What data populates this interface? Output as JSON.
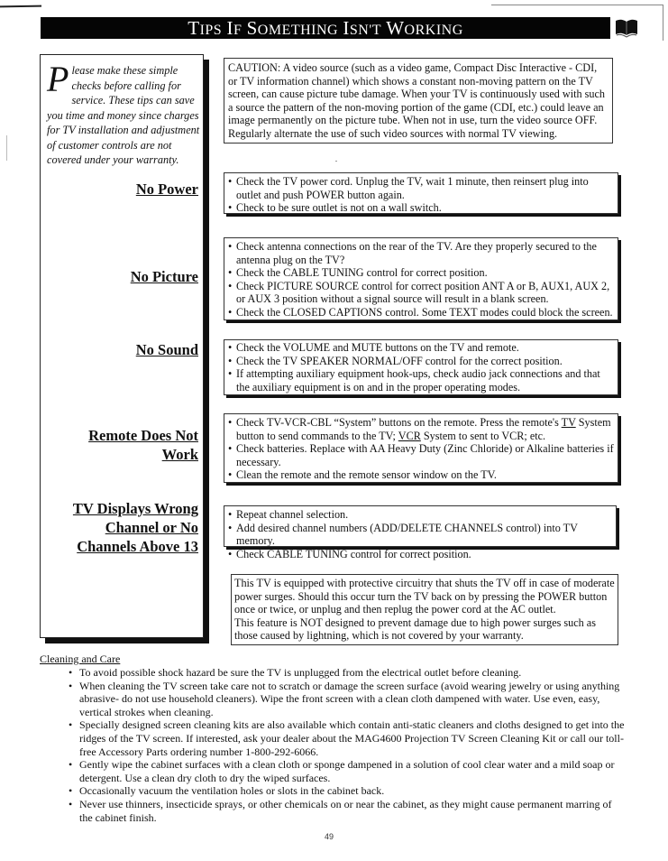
{
  "header": {
    "title_parts": [
      {
        "big": "T",
        "small": "IPS"
      },
      {
        "big": "I",
        "small": "F"
      },
      {
        "big": "S",
        "small": "OMETHING"
      },
      {
        "big": "I",
        "small": "SN'T"
      },
      {
        "big": "W",
        "small": "ORKING"
      }
    ],
    "title": "Tips If Something Isn't Working",
    "icon": "open-book-icon"
  },
  "intro": {
    "dropcap": "P",
    "text": "lease make these simple checks before calling for service.  These tips can save you time and money since charges for TV installation and adjustment of customer controls are not covered under your warranty."
  },
  "caution": {
    "text": "CAUTION: A video source (such as a video game, Compact Disc Interactive - CDI, or TV information channel) which shows a constant non-moving pattern on the TV screen, can cause picture tube damage. When your TV is continuously used with such a source the pattern of the non-moving portion of the game (CDI, etc.) could leave an image permanently on the picture tube. When not in use, turn the video source OFF. Regularly alternate the use of such video sources with normal TV viewing."
  },
  "sections": [
    {
      "heading": "No Power",
      "items": [
        "Check the TV power cord. Unplug the TV, wait 1 minute, then reinsert plug into outlet and push POWER button again.",
        "Check to be sure outlet is not on a wall switch."
      ]
    },
    {
      "heading": "No Picture",
      "items": [
        "Check antenna connections on the rear of the TV. Are they properly secured to the antenna plug on the TV?",
        "Check the CABLE TUNING control for correct position.",
        "Check PICTURE SOURCE control for correct position ANT A or B, AUX1, AUX 2, or AUX 3 position without a signal source will result in a blank screen.",
        "Check the CLOSED CAPTIONS control. Some TEXT modes could block the screen."
      ]
    },
    {
      "heading": "No Sound",
      "items": [
        "Check the VOLUME and MUTE buttons on the TV and remote.",
        "Check the TV SPEAKER NORMAL/OFF control for the correct position.",
        "If attempting auxiliary equipment hook-ups, check audio jack connections and that the auxiliary equipment is on and in the proper operating modes."
      ]
    },
    {
      "heading_line1": "Remote Does Not",
      "heading_line2": "Work",
      "items": [
        {
          "pre": "Check TV-VCR-CBL “System” buttons on the remote. Press the remote's ",
          "u1": "TV",
          "mid": " System button to send commands to the TV; ",
          "u2": "VCR",
          "post": " System to sent to VCR; etc."
        },
        "Check batteries.  Replace with AA Heavy Duty (Zinc Chloride) or Alkaline batteries if necessary.",
        "Clean the remote and the remote sensor window on the TV."
      ]
    },
    {
      "heading_line1": "TV Displays Wrong",
      "heading_line2": "Channel or No",
      "heading_line3": "Channels Above 13",
      "items": [
        "Repeat channel selection.",
        "Add desired channel numbers (ADD/DELETE CHANNELS control) into TV memory.",
        "Check CABLE TUNING control for correct position."
      ]
    }
  ],
  "surge_note": {
    "line1": "This TV is equipped with protective circuitry that shuts the TV off in case of moderate power surges. Should this occur turn the TV back on by pressing the POWER button once or twice, or unplug and then replug the power cord at the AC outlet.",
    "line2": "This feature is NOT designed to prevent damage due to high power surges such as those caused by lightning, which is not covered by your warranty."
  },
  "cleaning": {
    "title": "Cleaning and Care",
    "items": [
      "To avoid possible shock hazard be sure the TV is unplugged from the electrical outlet before cleaning.",
      "When cleaning the TV screen take care not to scratch or damage the screen surface (avoid wearing jewelry or using anything abrasive- do not use household cleaners). Wipe the front screen with a clean cloth dampened with water.  Use even, easy, vertical strokes when cleaning.",
      "Specially designed screen cleaning kits are also available which contain anti-static cleaners and cloths designed to get into the ridges of the TV screen. If interested, ask your dealer about the MAG4600 Projection TV Screen Cleaning Kit or call our toll-free Accessory Parts ordering number 1-800-292-6066.",
      "Gently wipe the cabinet surfaces with a clean cloth or sponge dampened in a solution of cool clear water and a mild soap or detergent. Use a clean dry cloth to dry the wiped surfaces.",
      "Occasionally vacuum the ventilation holes or slots in the cabinet back.",
      "Never use thinners, insecticide sprays, or other chemicals on or near the cabinet, as they might cause permanent marring of the cabinet finish."
    ]
  },
  "footer": {
    "page_number": "49"
  }
}
